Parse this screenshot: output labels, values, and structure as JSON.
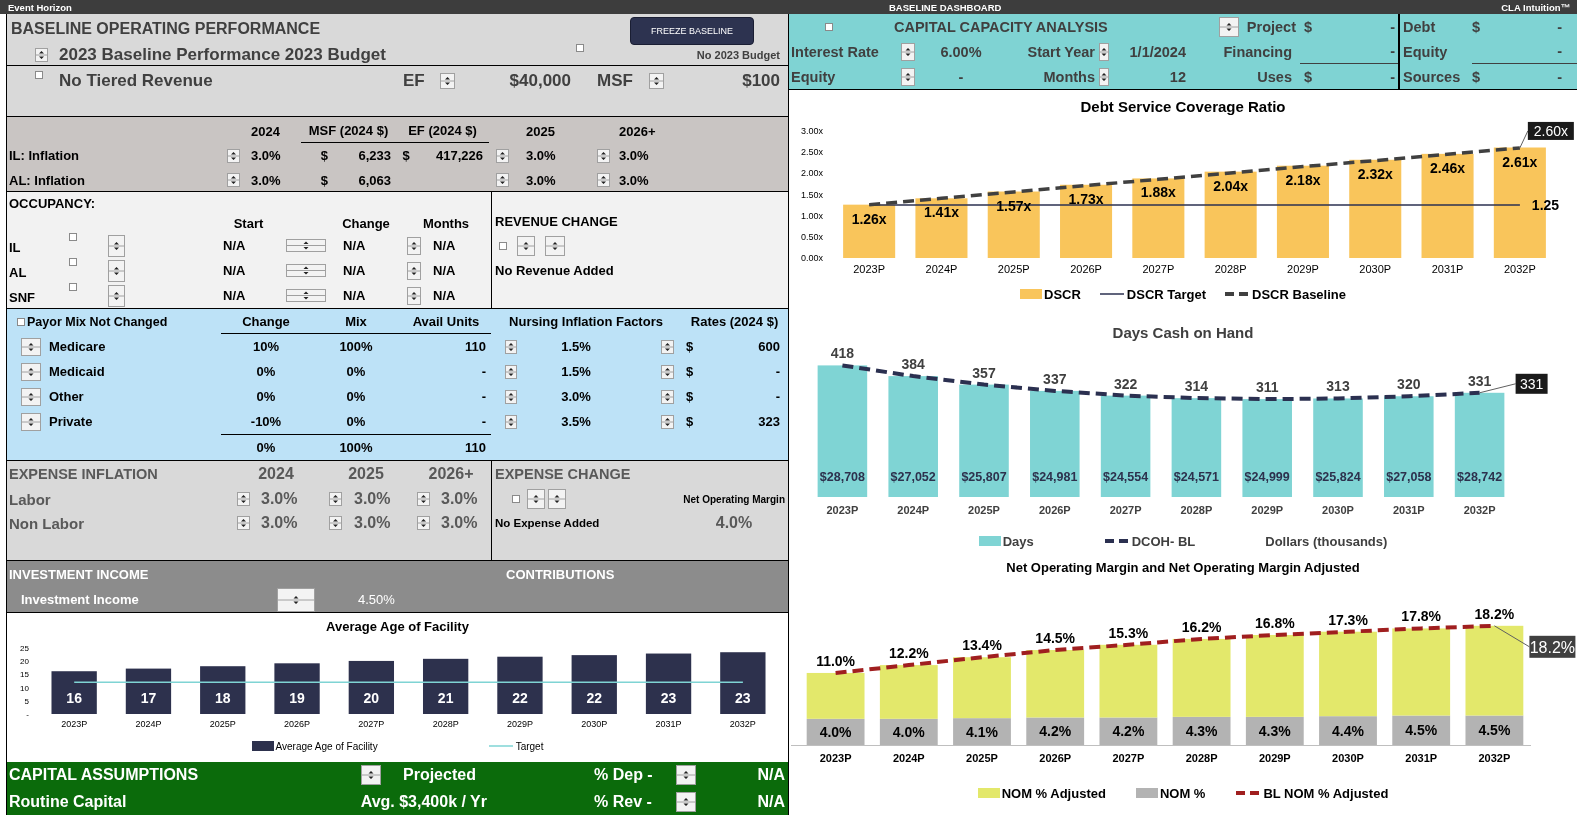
{
  "title_bar": {
    "app": "Event Horizon",
    "dashboard": "BASELINE DASHBOARD",
    "brand": "CLA Intuition™"
  },
  "baseline": {
    "title": "BASELINE OPERATING PERFORMANCE",
    "freeze_button": "FREEZE BASELINE",
    "budget_label": "2023 Baseline Performance 2023 Budget",
    "budget_checked": false,
    "no_budget_label": "No 2023 Budget"
  },
  "tiered": {
    "checked": false,
    "label": "No Tiered Revenue",
    "ef_label": "EF",
    "ef_value": "$40,000",
    "msf_label": "MSF",
    "msf_value": "$100"
  },
  "inflation": {
    "columns": [
      "2024",
      "MSF (2024 $)",
      "EF (2024 $)",
      "2025",
      "2026+"
    ],
    "rows": [
      {
        "label": "IL: Inflation",
        "rate_2024": "3.0%",
        "msf_currency": "$",
        "msf": "6,233",
        "ef_currency": "$",
        "ef": "417,226",
        "rate_2025": "3.0%",
        "rate_2026": "3.0%"
      },
      {
        "label": "AL: Inflation",
        "rate_2024": "3.0%",
        "msf_currency": "$",
        "msf": "6,063",
        "rate_2025": "3.0%",
        "rate_2026": "3.0%"
      }
    ]
  },
  "occupancy": {
    "title": "OCCUPANCY:",
    "columns": [
      "Start",
      "Change",
      "Months"
    ],
    "rows": [
      {
        "label": "IL",
        "checked": false,
        "start": "N/A",
        "change": "N/A",
        "months": "N/A"
      },
      {
        "label": "AL",
        "checked": false,
        "start": "N/A",
        "change": "N/A",
        "months": "N/A"
      },
      {
        "label": "SNF",
        "checked": false,
        "start": "N/A",
        "change": "N/A",
        "months": "N/A"
      }
    ]
  },
  "revenue_change": {
    "title": "REVENUE CHANGE",
    "checked": false,
    "status": "No Revenue Added"
  },
  "payor_mix": {
    "checked": false,
    "title": "Payor Mix Not Changed",
    "columns": [
      "Change",
      "Mix",
      "Avail Units",
      "Nursing Inflation Factors",
      "Rates (2024 $)"
    ],
    "rows": [
      {
        "label": "Medicare",
        "change": "10%",
        "mix": "100%",
        "units": "110",
        "factor": "1.5%",
        "currency": "$",
        "rate": "600"
      },
      {
        "label": "Medicaid",
        "change": "0%",
        "mix": "0%",
        "units": "-",
        "factor": "1.5%",
        "currency": "$",
        "rate": "-"
      },
      {
        "label": "Other",
        "change": "0%",
        "mix": "0%",
        "units": "-",
        "factor": "3.0%",
        "currency": "$",
        "rate": "-"
      },
      {
        "label": "Private",
        "change": "-10%",
        "mix": "0%",
        "units": "-",
        "factor": "3.5%",
        "currency": "$",
        "rate": "323"
      }
    ],
    "totals": {
      "change": "0%",
      "mix": "100%",
      "units": "110"
    }
  },
  "expense_inflation": {
    "title": "EXPENSE INFLATION",
    "columns": [
      "2024",
      "2025",
      "2026+"
    ],
    "rows": [
      {
        "label": "Labor",
        "values": [
          "3.0%",
          "3.0%",
          "3.0%"
        ]
      },
      {
        "label": "Non Labor",
        "values": [
          "3.0%",
          "3.0%",
          "3.0%"
        ]
      }
    ]
  },
  "expense_change": {
    "title": "EXPENSE CHANGE",
    "checked": false,
    "status": "No Expense Added",
    "nom_label": "Net Operating Margin",
    "nom_value": "4.0%"
  },
  "investment": {
    "title": "INVESTMENT INCOME",
    "contributions": "CONTRIBUTIONS",
    "label": "Investment Income",
    "value": "4.50%"
  },
  "age_chart": {
    "chart_data": {
      "type": "bar",
      "title": "Average Age of Facility",
      "categories": [
        "2023P",
        "2024P",
        "2025P",
        "2026P",
        "2027P",
        "2028P",
        "2029P",
        "2030P",
        "2031P",
        "2032P"
      ],
      "series": [
        {
          "name": "Average Age of Facility",
          "type": "bar",
          "color": "#2d314d",
          "values": [
            16.2,
            17.2,
            18.1,
            19.2,
            20.1,
            20.9,
            21.7,
            22.3,
            22.9,
            23.4
          ],
          "value_labels": [
            "16",
            "17",
            "18",
            "19",
            "20",
            "21",
            "22",
            "22",
            "23",
            "23"
          ]
        },
        {
          "name": "Target",
          "type": "line",
          "line_style": "solid",
          "color": "#7fd4d4",
          "values": [
            12,
            12,
            12,
            12,
            12,
            12,
            12,
            12,
            12,
            12
          ]
        }
      ],
      "ylim": [
        0,
        25
      ],
      "yticks": [
        {
          "value": 0,
          "label": "-"
        },
        5,
        10,
        15,
        20,
        25
      ],
      "legend": true
    }
  },
  "capital": {
    "title": "CAPITAL ASSUMPTIONS",
    "mode": "Projected",
    "dep_label": "% Dep -",
    "dep_value": "N/A",
    "routine_label": "Routine Capital",
    "routine_value": "Avg. $3,400k / Yr",
    "rev_label": "% Rev -",
    "rev_value": "N/A"
  },
  "capacity": {
    "checked": false,
    "title": "CAPITAL CAPACITY ANALYSIS",
    "rate": {
      "label": "Interest Rate",
      "value": "6.00%"
    },
    "equity_input": {
      "label": "Equity",
      "value": "-"
    },
    "start_year": {
      "label": "Start Year",
      "value": "1/1/2024"
    },
    "months": {
      "label": "Months",
      "value": "12"
    },
    "project": {
      "label": "Project",
      "currency": "$",
      "value": "-"
    },
    "financing": {
      "label": "Financing",
      "value": "-"
    },
    "uses": {
      "label": "Uses",
      "currency": "$",
      "value": "-"
    },
    "debt": {
      "label": "Debt",
      "currency": "$",
      "value": "-"
    },
    "equity": {
      "label": "Equity",
      "value": "-"
    },
    "sources": {
      "label": "Sources",
      "currency": "$",
      "value": "-"
    }
  },
  "dscr_chart": {
    "chart_data": {
      "type": "bar",
      "title": "Debt Service Coverage Ratio",
      "categories": [
        "2023P",
        "2024P",
        "2025P",
        "2026P",
        "2027P",
        "2028P",
        "2029P",
        "2030P",
        "2031P",
        "2032P"
      ],
      "series": [
        {
          "name": "DSCR",
          "type": "bar",
          "color": "#f9c55b",
          "values": [
            1.26,
            1.41,
            1.57,
            1.73,
            1.88,
            2.04,
            2.18,
            2.32,
            2.46,
            2.61
          ],
          "value_labels": [
            "1.26x",
            "1.41x",
            "1.57x",
            "1.73x",
            "1.88x",
            "2.04x",
            "2.18x",
            "2.32x",
            "2.46x",
            "2.61x"
          ]
        },
        {
          "name": "DSCR Target",
          "type": "line",
          "line_style": "solid",
          "color": "#2b3050",
          "values": [
            1.25,
            1.25,
            1.25,
            1.25,
            1.25,
            1.25,
            1.25,
            1.25,
            1.25,
            1.25
          ]
        },
        {
          "name": "DSCR Baseline",
          "type": "line",
          "line_style": "dashed",
          "color": "#404040",
          "values": [
            1.26,
            1.41,
            1.56,
            1.71,
            1.86,
            2.01,
            2.16,
            2.3,
            2.45,
            2.6
          ]
        }
      ],
      "ylim": [
        0,
        3
      ],
      "yticks": [
        {
          "value": 0,
          "label": "0.00x"
        },
        {
          "value": 0.5,
          "label": "0.50x"
        },
        {
          "value": 1,
          "label": "1.00x"
        },
        {
          "value": 1.5,
          "label": "1.50x"
        },
        {
          "value": 2,
          "label": "2.00x"
        },
        {
          "value": 2.5,
          "label": "2.50x"
        },
        {
          "value": 3,
          "label": "3.00x"
        }
      ],
      "legend": true,
      "annotations": [
        {
          "x": "2032P",
          "y": 1.25,
          "text": "1.25"
        },
        {
          "x": "2032P",
          "y": 2.6,
          "text": "2.60x"
        }
      ]
    }
  },
  "days_chart": {
    "chart_data": {
      "type": "bar",
      "title": "Days Cash on Hand",
      "categories": [
        "2023P",
        "2024P",
        "2025P",
        "2026P",
        "2027P",
        "2028P",
        "2029P",
        "2030P",
        "2031P",
        "2032P"
      ],
      "series": [
        {
          "name": "Days",
          "type": "bar",
          "color": "#7fd4d4",
          "values": [
            418,
            384,
            357,
            337,
            322,
            314,
            311,
            313,
            320,
            331
          ],
          "value_labels": [
            "418",
            "384",
            "357",
            "337",
            "322",
            "314",
            "311",
            "313",
            "320",
            "331"
          ]
        },
        {
          "name": "DCOH- BL",
          "type": "line",
          "line_style": "dashed",
          "color": "#2b3050",
          "values": [
            418,
            384,
            357,
            337,
            322,
            314,
            311,
            313,
            320,
            331
          ]
        }
      ],
      "legend": true,
      "annotations": [
        "$28,708",
        "$27,052",
        "$25,807",
        "$24,981",
        "$24,554",
        "$24,571",
        "$24,999",
        "$25,824",
        "$27,058",
        "$28,742",
        "Dollars (thousands)",
        {
          "x": "2032P",
          "y": 331,
          "text": "331"
        }
      ]
    }
  },
  "nom_chart": {
    "chart_data": {
      "type": "bar",
      "title": "Net Operating Margin and Net Operating Margin Adjusted",
      "categories": [
        "2023P",
        "2024P",
        "2025P",
        "2026P",
        "2027P",
        "2028P",
        "2029P",
        "2030P",
        "2031P",
        "2032P"
      ],
      "stacked": true,
      "series": [
        {
          "name": "NOM  %",
          "type": "bar",
          "color": "#b3b3b3",
          "values": [
            4.0,
            4.0,
            4.1,
            4.2,
            4.2,
            4.3,
            4.3,
            4.4,
            4.5,
            4.5
          ],
          "value_labels": [
            "4.0%",
            "4.0%",
            "4.1%",
            "4.2%",
            "4.2%",
            "4.3%",
            "4.3%",
            "4.4%",
            "4.5%",
            "4.5%"
          ]
        },
        {
          "name": "NOM % Adjusted",
          "type": "bar",
          "color": "#e3e86b",
          "values": [
            7.0,
            8.2,
            9.3,
            10.3,
            11.1,
            11.9,
            12.5,
            12.9,
            13.3,
            13.7
          ]
        },
        {
          "name": "BL NOM % Adjusted",
          "type": "line",
          "line_style": "dashed",
          "color": "#a01f1f",
          "values": [
            11.0,
            12.2,
            13.4,
            14.5,
            15.3,
            16.2,
            16.8,
            17.3,
            17.8,
            18.2
          ]
        }
      ],
      "legend": true,
      "annotations": [
        {
          "x": "2023P",
          "y": 11.0,
          "text": "11.0%"
        },
        {
          "x": "2024P",
          "y": 12.2,
          "text": "12.2%"
        },
        {
          "x": "2025P",
          "y": 13.4,
          "text": "13.4%"
        },
        {
          "x": "2026P",
          "y": 14.5,
          "text": "14.5%"
        },
        {
          "x": "2027P",
          "y": 15.3,
          "text": "15.3%"
        },
        {
          "x": "2028P",
          "y": 16.2,
          "text": "16.2%"
        },
        {
          "x": "2029P",
          "y": 16.8,
          "text": "16.8%"
        },
        {
          "x": "2030P",
          "y": 17.3,
          "text": "17.3%"
        },
        {
          "x": "2031P",
          "y": 17.8,
          "text": "17.8%"
        },
        {
          "x": "2032P",
          "y": 18.2,
          "text": "18.2%"
        },
        {
          "x": "2032P",
          "y": 18.2,
          "text": "18.2%"
        }
      ]
    }
  }
}
